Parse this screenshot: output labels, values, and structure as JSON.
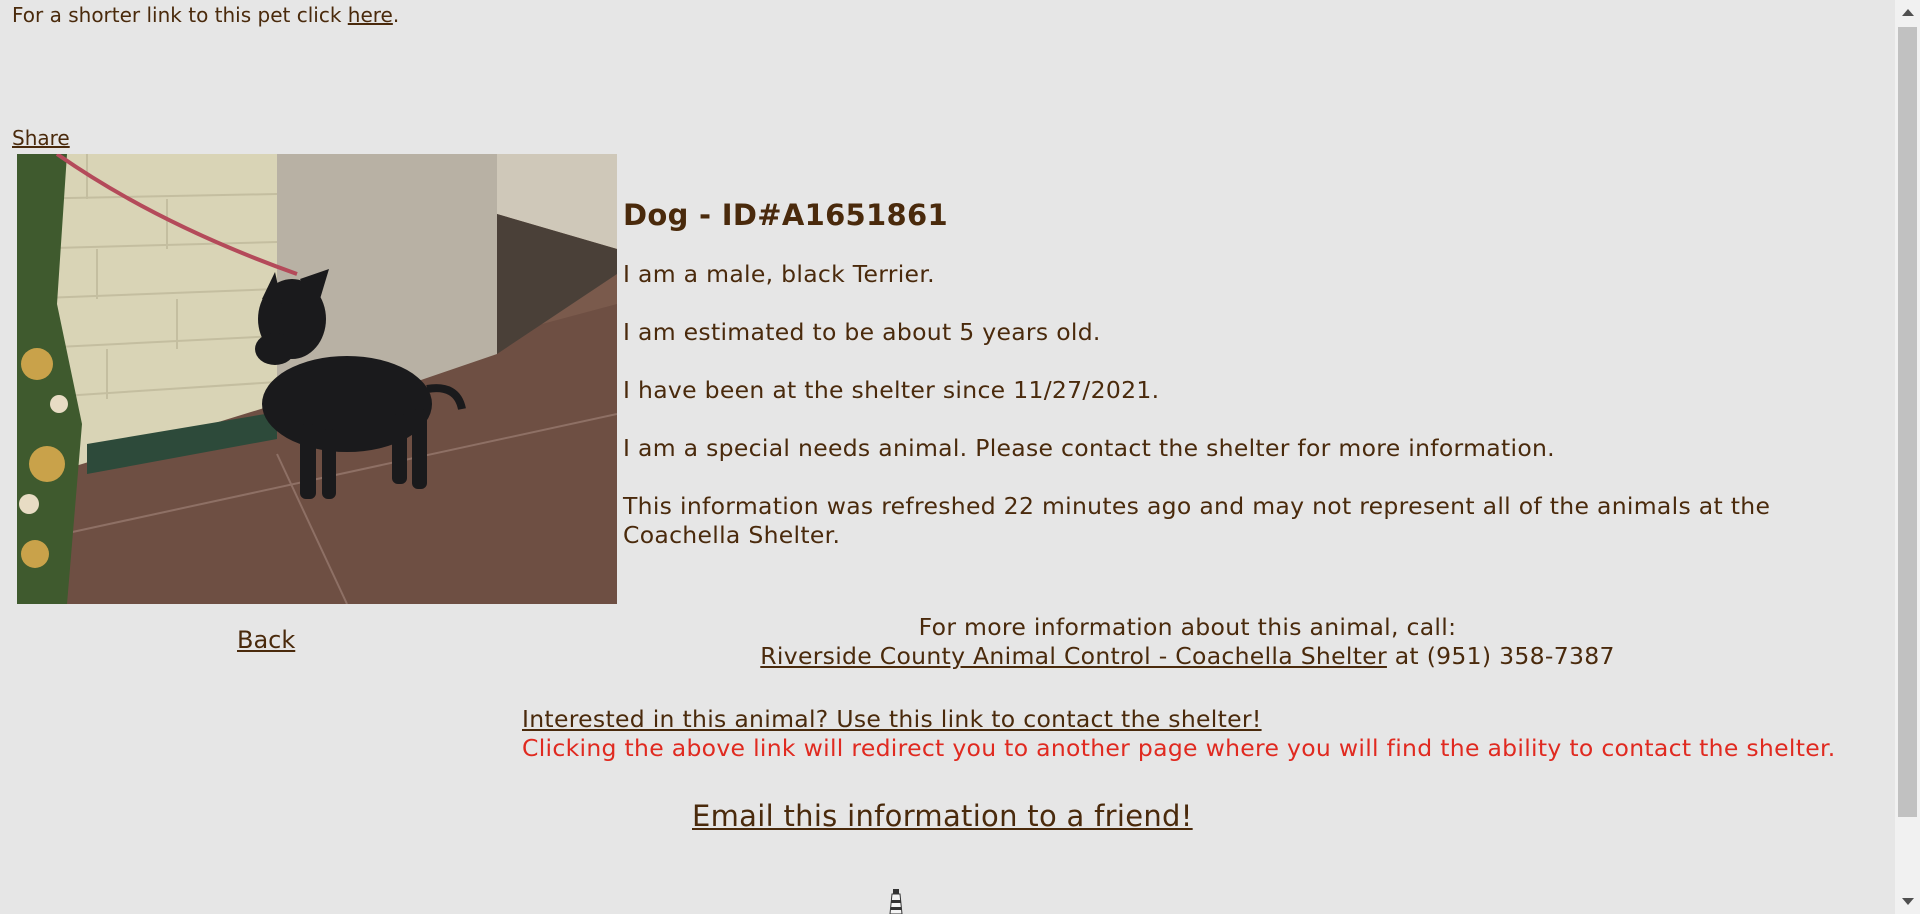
{
  "top": {
    "short_link_prefix": "For a shorter link to this pet click ",
    "short_link_text": "here",
    "short_link_suffix": "."
  },
  "share_label": "Share",
  "animal": {
    "heading": "Dog - ID#A1651861",
    "description": "I am a male, black Terrier.",
    "age": "I am estimated to be about 5 years old.",
    "shelter_since": "I have been at the shelter since 11/27/2021.",
    "special_needs": "I am a special needs animal. Please contact the shelter for more information.",
    "refresh_note": "This information was refreshed 22 minutes ago and may not represent all of the animals at the Coachella Shelter."
  },
  "back_label": "Back",
  "contact": {
    "intro": "For more information about this animal, call:",
    "shelter_link": "Riverside County Animal Control - Coachella Shelter",
    "phone_prefix": " at ",
    "phone": "(951) 358-7387"
  },
  "interest": {
    "link_text": "Interested in this animal? Use this link to contact the shelter!",
    "warning": "Clicking the above link will redirect you to another page where you will find the ability to contact the shelter."
  },
  "email_label": "Email this information to a friend!",
  "colors": {
    "background": "#e6e6e6",
    "text": "#4a2a0c",
    "warning": "#e02a20"
  }
}
